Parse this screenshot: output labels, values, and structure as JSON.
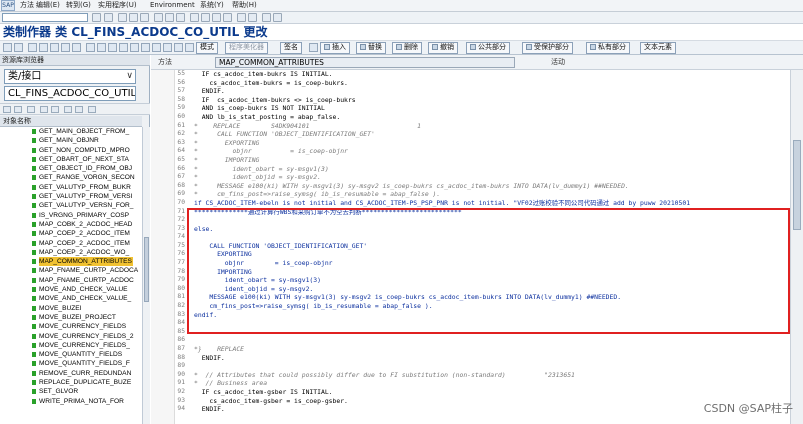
{
  "menubar": {
    "logo": "SAP",
    "items": [
      "方法",
      "编辑(E)",
      "转到(G)",
      "实用程序(U)",
      "Environment",
      "系统(Y)",
      "帮助(H)"
    ]
  },
  "toolbar": {
    "command_field_value": "",
    "icons": [
      "enter-icon",
      "save-icon",
      "back-icon",
      "exit-icon",
      "cancel-icon",
      "print-icon",
      "find-icon",
      "find-next-icon",
      "first-page-icon",
      "prev-page-icon",
      "next-page-icon",
      "last-page-icon",
      "new-session-icon",
      "shortcut-icon",
      "help-icon",
      "layout-icon"
    ]
  },
  "title": "类制作器 类 CL_FINS_ACDOC_CO_UTIL 更改",
  "app_toolbar": {
    "buttons": [
      {
        "label": "模式",
        "disabled": false
      },
      {
        "label": "程序美化器",
        "disabled": true
      },
      {
        "label": "签名",
        "disabled": false
      },
      {
        "label": "插入",
        "disabled": false
      },
      {
        "label": "替换",
        "disabled": false
      },
      {
        "label": "删除",
        "disabled": false
      },
      {
        "label": "撤销",
        "disabled": false
      },
      {
        "label": "公共部分",
        "disabled": false
      },
      {
        "label": "受保护部分",
        "disabled": false
      },
      {
        "label": "私有部分",
        "disabled": false
      },
      {
        "label": "文本元素",
        "disabled": false
      }
    ]
  },
  "left_pane": {
    "header": "资源库浏览器",
    "type_select": "类/接口",
    "object_name": "CL_FINS_ACDOC_CO_UTIL",
    "column_header": "对象名称",
    "items": [
      "GET_MAIN_OBJECT_FROM_",
      "GET_MAIN_OBJNR",
      "GET_NON_COMPLTD_MPRO",
      "GET_OBART_OF_NEXT_STA",
      "GET_OBJECT_ID_FROM_OBJ",
      "GET_RANGE_VORGN_SECON",
      "GET_VALUTYP_FROM_BUKR",
      "GET_VALUTYP_FROM_VERSI",
      "GET_VALUTYP_VERSN_FOR_",
      "IS_VRGNG_PRIMARY_COSP",
      "MAP_COBK_2_ACDOC_HEAD",
      "MAP_COEP_2_ACDOC_ITEM",
      "MAP_COEP_2_ACDOC_ITEM",
      "MAP_COEP_2_ACDOC_WO_",
      "MAP_COMMON_ATTRIBUTES",
      "MAP_FNAME_CURTP_ACDOCA",
      "MAP_FNAME_CURTP_ACDOC",
      "MOVE_AND_CHECK_VALUE",
      "MOVE_AND_CHECK_VALUE_",
      "MOVE_BUZEI",
      "MOVE_BUZEI_PROJECT",
      "MOVE_CURRENCY_FIELDS",
      "MOVE_CURRENCY_FIELDS_2",
      "MOVE_CURRENCY_FIELDS_",
      "MOVE_QUANTITY_FIELDS",
      "MOVE_QUANTITY_FIELDS_F",
      "REMOVE_CURR_REDUNDAN",
      "REPLACE_DUPLICATE_BUZE",
      "SET_GLVOR",
      "WRITE_PRIMA_NOTA_FOR"
    ],
    "selected_index": 14
  },
  "editor": {
    "method_label": "方法",
    "method_name": "MAP_COMMON_ATTRIBUTES",
    "status_label": "活动",
    "lines": [
      {
        "n": "55",
        "t": "  IF cs_acdoc_item-bukrs IS INITIAL.",
        "k": "code"
      },
      {
        "n": "56",
        "t": "    cs_acdoc_item-bukrs = is_coep-bukrs.",
        "k": "code"
      },
      {
        "n": "57",
        "t": "  ENDIF.",
        "k": "code"
      },
      {
        "n": "58",
        "t": "  IF  cs_acdoc_item-bukrs <> is_coep-bukrs",
        "k": "code"
      },
      {
        "n": "59",
        "t": "  AND is_coep-bukrs IS NOT INITIAL",
        "k": "code"
      },
      {
        "n": "60",
        "t": "  AND lb_is_stat_posting = abap_false.",
        "k": "code"
      },
      {
        "n": "61",
        "t": "*    REPLACE        S4DK904101                            1",
        "k": "cm"
      },
      {
        "n": "62",
        "t": "*     CALL FUNCTION 'OBJECT_IDENTIFICATION_GET'",
        "k": "cm"
      },
      {
        "n": "63",
        "t": "*       EXPORTING",
        "k": "cm"
      },
      {
        "n": "64",
        "t": "*         objnr          = is_coep-objnr",
        "k": "cm"
      },
      {
        "n": "65",
        "t": "*       IMPORTING",
        "k": "cm"
      },
      {
        "n": "66",
        "t": "*         ident_obart = sy-msgv1(3)",
        "k": "cm"
      },
      {
        "n": "67",
        "t": "*         ident_objid = sy-msgv2.",
        "k": "cm"
      },
      {
        "n": "68",
        "t": "*     MESSAGE e100(ki) WITH sy-msgv1(3) sy-msgv2 is_coep-bukrs cs_acdoc_item-bukrs INTO DATA(lv_dummy1) ##NEEDED.",
        "k": "cm"
      },
      {
        "n": "69",
        "t": "*     cm_fins_post=>raise_symsg( ib_is_resumable = abap_false ).",
        "k": "cm"
      },
      {
        "n": "70",
        "t": "if CS_ACDOC_ITEM-ebeln is not initial and CS_ACDOC_ITEM-PS_PSP_PNR is not initial. \"VF02过账校验不同公司代码通过 add by puww 20210501",
        "k": "hl"
      },
      {
        "n": "71",
        "t": "**************通过计算行WBS和采购订单不为空去判断**************************",
        "k": "hl"
      },
      {
        "n": "72",
        "t": "",
        "k": "hl"
      },
      {
        "n": "73",
        "t": "else.",
        "k": "hl"
      },
      {
        "n": "74",
        "t": "",
        "k": "hl"
      },
      {
        "n": "75",
        "t": "    CALL FUNCTION 'OBJECT_IDENTIFICATION_GET'",
        "k": "hl"
      },
      {
        "n": "76",
        "t": "      EXPORTING",
        "k": "hl"
      },
      {
        "n": "77",
        "t": "        objnr        = is_coep-objnr",
        "k": "hl"
      },
      {
        "n": "78",
        "t": "      IMPORTING",
        "k": "hl"
      },
      {
        "n": "79",
        "t": "        ident_obart = sy-msgv1(3)",
        "k": "hl"
      },
      {
        "n": "80",
        "t": "        ident_objid = sy-msgv2.",
        "k": "hl"
      },
      {
        "n": "81",
        "t": "    MESSAGE e100(ki) WITH sy-msgv1(3) sy-msgv2 is_coep-bukrs cs_acdoc_item-bukrs INTO DATA(lv_dummy1) ##NEEDED.",
        "k": "hl"
      },
      {
        "n": "82",
        "t": "    cm_fins_post=>raise_symsg( ib_is_resumable = abap_false ).",
        "k": "hl"
      },
      {
        "n": "83",
        "t": "endif.",
        "k": "hl"
      },
      {
        "n": "84",
        "t": "",
        "k": "code"
      },
      {
        "n": "85",
        "t": "",
        "k": "code"
      },
      {
        "n": "86",
        "t": "",
        "k": "code"
      },
      {
        "n": "87",
        "t": "*}    REPLACE",
        "k": "cm"
      },
      {
        "n": "88",
        "t": "  ENDIF.",
        "k": "code"
      },
      {
        "n": "89",
        "t": "",
        "k": "code"
      },
      {
        "n": "90",
        "t": "*  // Attributes that could possibly differ due to FI substitution (non-standard)          \"2313651",
        "k": "cm"
      },
      {
        "n": "91",
        "t": "*  // Business area",
        "k": "cm"
      },
      {
        "n": "92",
        "t": "  IF cs_acdoc_item-gsber IS INITIAL.",
        "k": "code"
      },
      {
        "n": "93",
        "t": "    cs_acdoc_item-gsber = is_coep-gsber.",
        "k": "code"
      },
      {
        "n": "94",
        "t": "  ENDIF.",
        "k": "code"
      }
    ]
  },
  "watermark": "CSDN @SAP柱子",
  "colors": {
    "title": "#0b3a8c",
    "selection": "#f1c232",
    "highlight_box": "#e02020",
    "keyword_blue": "#0b2f9e",
    "string_green": "#2c8a2c",
    "comment_gray": "#7a7a7a"
  }
}
